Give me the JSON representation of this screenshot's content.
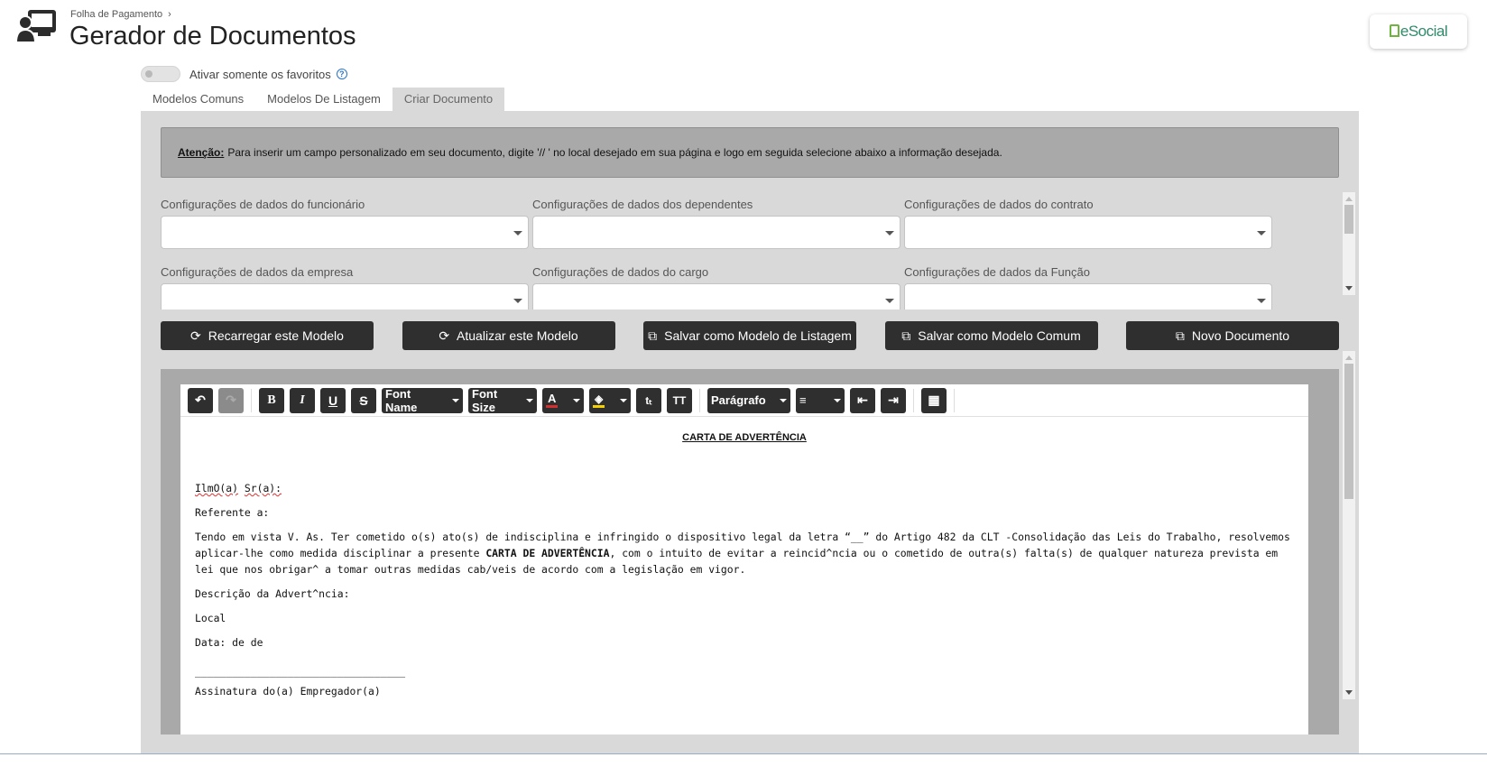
{
  "header": {
    "breadcrumb": "Folha de Pagamento",
    "title": "Gerador de Documentos",
    "esocial_label": "eSocial"
  },
  "favorites": {
    "label": "Ativar somente os favoritos",
    "enabled": false
  },
  "tabs": [
    {
      "label": "Modelos Comuns",
      "active": false
    },
    {
      "label": "Modelos De Listagem",
      "active": false
    },
    {
      "label": "Criar Documento",
      "active": true
    }
  ],
  "attention": {
    "prefix": "Atenção:",
    "text": "Para inserir um campo personalizado em seu documento, digite '// ' no local desejado em sua página e logo em seguida selecione abaixo a informação desejada."
  },
  "config_fields": [
    {
      "label": "Configurações de dados do funcionário",
      "value": ""
    },
    {
      "label": "Configurações de dados dos dependentes",
      "value": ""
    },
    {
      "label": "Configurações de dados do contrato",
      "value": ""
    },
    {
      "label": "Configurações de dados da empresa",
      "value": ""
    },
    {
      "label": "Configurações de dados do cargo",
      "value": ""
    },
    {
      "label": "Configurações de dados da Função",
      "value": ""
    }
  ],
  "actions": [
    {
      "label": "Recarregar este Modelo",
      "icon": "refresh-icon"
    },
    {
      "label": "Atualizar este Modelo",
      "icon": "refresh-icon"
    },
    {
      "label": "Salvar como Modelo de Listagem",
      "icon": "copy-icon"
    },
    {
      "label": "Salvar como Modelo Comum",
      "icon": "copy-icon"
    },
    {
      "label": "Novo Documento",
      "icon": "copy-icon"
    }
  ],
  "toolbar": {
    "font_name": "Font Name",
    "font_size": "Font Size",
    "paragraph": "Parágrafo"
  },
  "document": {
    "title": "CARTA DE ADVERTÊNCIA",
    "greeting_a": "IlmO(a)",
    "greeting_b": "Sr(a):",
    "ref": "Referente a:",
    "body_1": "Tendo em vista V. As. Ter cometido o(s) ato(s) de indisciplina e infringido o dispositivo legal da letra “__” do Artigo 482 da CLT -Consolidação das Leis do Trabalho, resolvemos aplicar-lhe como medida disciplinar a presente ",
    "body_bold": "CARTA DE ADVERTÊNCIA",
    "body_2": ", com o intuito de evitar a reincid^ncia ou o cometido de outra(s) falta(s) de qualquer natureza prevista em lei que nos obrigar^ a tomar outras medidas cab/veis de acordo com a legislação em vigor.",
    "desc": "Descrição da Advert^ncia:",
    "local": "Local",
    "date": "Data: de de",
    "line": "__________________________________",
    "signature": "Assinatura do(a) Empregador(a)"
  }
}
